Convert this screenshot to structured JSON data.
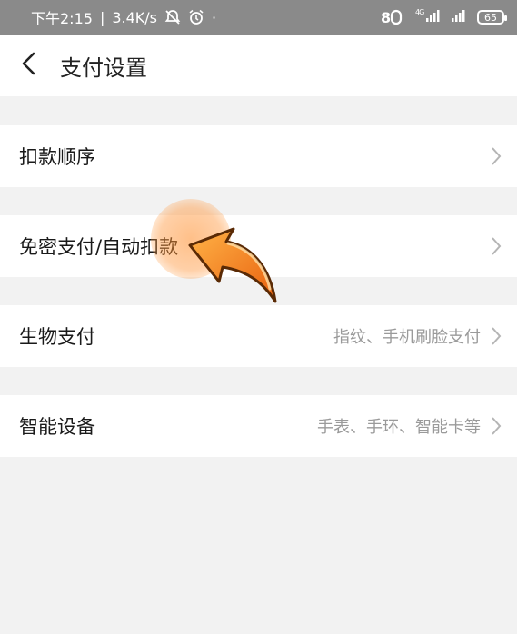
{
  "status_bar": {
    "time": "下午2:15",
    "speed": "3.4K/s",
    "network_label": "4G",
    "battery": "65"
  },
  "header": {
    "title": "支付设置"
  },
  "rows": [
    {
      "label": "扣款顺序",
      "value": ""
    },
    {
      "label": "免密支付/自动扣款",
      "value": ""
    },
    {
      "label": "生物支付",
      "value": "指纹、手机刷脸支付"
    },
    {
      "label": "智能设备",
      "value": "手表、手环、智能卡等"
    }
  ],
  "icons": {
    "back": "back-arrow-icon",
    "chevron": "chevron-right-icon",
    "mute": "bell-off-icon",
    "alarm": "alarm-icon",
    "pointer": "pointer-arrow-icon"
  },
  "colors": {
    "background": "#f2f2f2",
    "status_bar": "#8a8a8a",
    "pointer_orange": "#f07a1a"
  }
}
